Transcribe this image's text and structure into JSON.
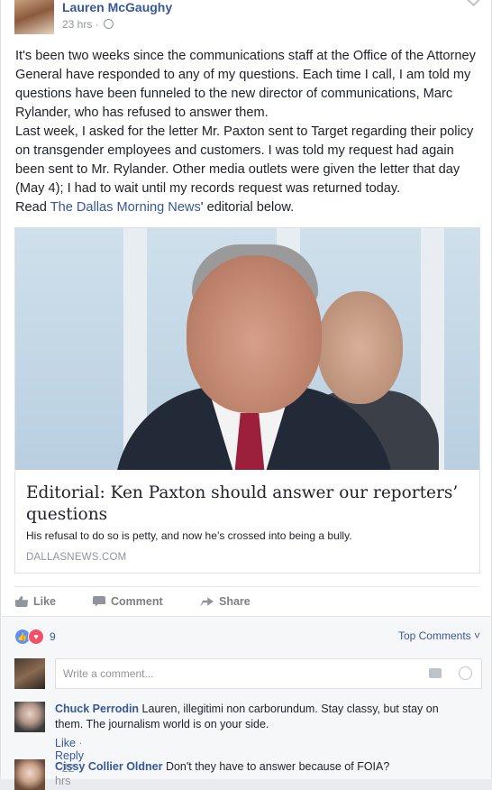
{
  "post": {
    "author": "Lauren McGaughy",
    "time": "23 hrs",
    "dot": "·",
    "paragraphs": [
      "It's been two weeks since the communications staff at the Office of the Attorney General have responded to any of my questions. Each time I call, I am told my questions have been funneled to the new director of communications, Marc Rylander, who has refused to answer them.",
      "Last week, I asked for the letter Mr. Paxton sent to Target regarding their policy on transgender employees and customers. I was told my request had again been sent to Mr. Rylander. Other media outlets were given the letter that day (May 4); I had to wait until my records request was returned today."
    ],
    "read_prefix": "Read ",
    "read_link": "The Dallas Morning News",
    "read_suffix": "' editorial below."
  },
  "link_card": {
    "title": "Editorial: Ken Paxton should answer our reporters’ questions",
    "description": "His refusal to do so is petty, and now he’s crossed into being a bully.",
    "domain": "DALLASNEWS.COM"
  },
  "actions": {
    "like": "Like",
    "comment": "Comment",
    "share": "Share"
  },
  "reactions": {
    "count": "9",
    "sort_label": "Top Comments ˅"
  },
  "write_comment": {
    "placeholder": "Write a comment..."
  },
  "comments": [
    {
      "name": "Chuck Perrodin",
      "text": " Lauren, illegitimi non carborundum. Stay classy, but stay on them. The journalism world is on your side.",
      "like": "Like",
      "reply": "Reply",
      "time": "22 hrs"
    },
    {
      "name": "Cissy Collier Oldner",
      "text": " Don't they have to answer because of FOIA?"
    }
  ],
  "icons": {
    "like": "thumbs-up-icon",
    "comment": "speech-bubble-icon",
    "share": "share-arrow-icon",
    "privacy": "globe-icon",
    "camera": "camera-icon",
    "emoji": "smiley-icon"
  },
  "colors": {
    "link": "#365899",
    "like_reaction": "#5890ff",
    "love_reaction": "#f25268"
  }
}
